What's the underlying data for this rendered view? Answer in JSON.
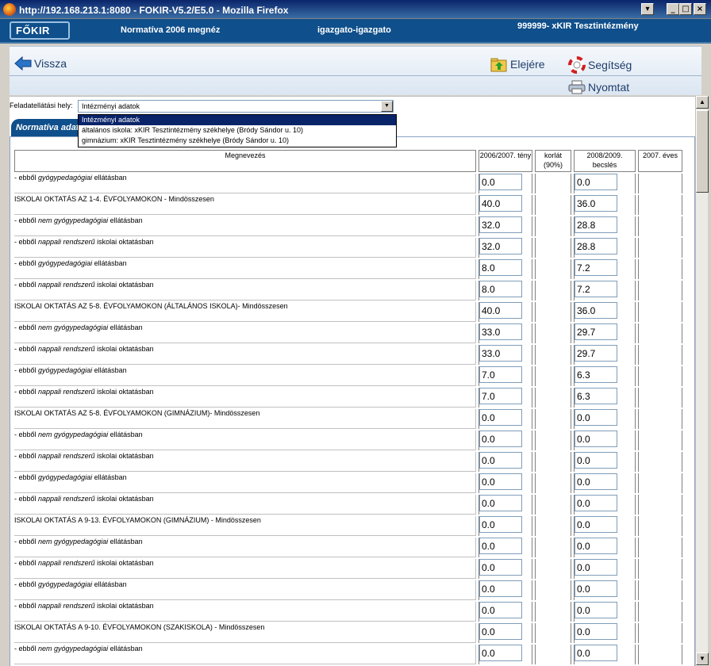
{
  "window": {
    "title": "http://192.168.213.1:8080 - FOKIR-V5.2/E5.0 - Mozilla Firefox",
    "controls": [
      "▾",
      "_",
      "□",
      "×"
    ]
  },
  "header": {
    "logo": "FŐKIR",
    "module": "Normatíva 2006 megnéz",
    "user": "igazgato-igazgato",
    "institution": "999999- xKIR Tesztintézmény"
  },
  "toolbar": {
    "back": "Vissza",
    "top": "Elejére",
    "help": "Segítség",
    "print": "Nyomtat"
  },
  "form": {
    "feladat_label": "Feladatellátási hely:",
    "selected": "Intézményi adatok",
    "options": [
      "Intézményi adatok",
      "általános iskola: xKIR Tesztintézmény székhelye (Bródy Sándor u. 10)",
      "gimnázium: xKIR Tesztintézmény székhelye (Bródy Sándor u. 10)"
    ],
    "tab": "Normatíva adat"
  },
  "table": {
    "headers": [
      "Megnevezés",
      "2006/2007. tény",
      "korlát (90%)",
      "2008/2009. becslés",
      "2007. éves"
    ],
    "rows": [
      {
        "pre": "- ebből ",
        "em": "gyógypedagógiai",
        "post": " ellátásban",
        "v1": "0.0",
        "v2": "0.0"
      },
      {
        "pre": "ISKOLAI OKTATÁS AZ 1-4. ÉVFOLYAMOKON - Mindösszesen",
        "em": "",
        "post": "",
        "v1": "40.0",
        "v2": "36.0"
      },
      {
        "pre": " - ebből ",
        "em": "nem gyógypedagógiai",
        "post": " ellátásban",
        "v1": "32.0",
        "v2": "28.8"
      },
      {
        "pre": "  - ebből ",
        "em": "nappali rendszerű",
        "post": " iskolai oktatásban",
        "v1": "32.0",
        "v2": "28.8"
      },
      {
        "pre": " - ebből ",
        "em": "gyógypedagógiai",
        "post": " ellátásban",
        "v1": "8.0",
        "v2": "7.2"
      },
      {
        "pre": "  - ebből ",
        "em": "nappali rendszerű",
        "post": " iskolai oktatásban",
        "v1": "8.0",
        "v2": "7.2"
      },
      {
        "pre": "ISKOLAI OKTATÁS AZ 5-8. ÉVFOLYAMOKON (ÁLTALÁNOS ISKOLA)- Mindösszesen",
        "em": "",
        "post": "",
        "v1": "40.0",
        "v2": "36.0"
      },
      {
        "pre": " - ebből ",
        "em": "nem gyógypedagógiai",
        "post": " ellátásban",
        "v1": "33.0",
        "v2": "29.7"
      },
      {
        "pre": "  - ebből ",
        "em": "nappali rendszerű",
        "post": " iskolai oktatásban",
        "v1": "33.0",
        "v2": "29.7"
      },
      {
        "pre": " - ebből ",
        "em": "gyógypedagógiai",
        "post": " ellátásban",
        "v1": "7.0",
        "v2": "6.3"
      },
      {
        "pre": "  - ebből ",
        "em": "nappali rendszerű",
        "post": " iskolai oktatásban",
        "v1": "7.0",
        "v2": "6.3"
      },
      {
        "pre": "ISKOLAI OKTATÁS AZ 5-8. ÉVFOLYAMOKON (GIMNÁZIUM)- Mindösszesen",
        "em": "",
        "post": "",
        "v1": "0.0",
        "v2": "0.0"
      },
      {
        "pre": " - ebből ",
        "em": "nem gyógypedagógiai",
        "post": " ellátásban",
        "v1": "0.0",
        "v2": "0.0"
      },
      {
        "pre": "  - ebből ",
        "em": "nappali rendszerű",
        "post": " iskolai oktatásban",
        "v1": "0.0",
        "v2": "0.0"
      },
      {
        "pre": " - ebből ",
        "em": "gyógypedagógiai",
        "post": " ellátásban",
        "v1": "0.0",
        "v2": "0.0"
      },
      {
        "pre": "  - ebből ",
        "em": "nappali rendszerű",
        "post": " iskolai oktatásban",
        "v1": "0.0",
        "v2": "0.0"
      },
      {
        "pre": "ISKOLAI OKTATÁS A 9-13. ÉVFOLYAMOKON (GIMNÁZIUM) - Mindösszesen",
        "em": "",
        "post": "",
        "v1": "0.0",
        "v2": "0.0"
      },
      {
        "pre": " - ebből ",
        "em": "nem gyógypedagógiai",
        "post": " ellátásban",
        "v1": "0.0",
        "v2": "0.0"
      },
      {
        "pre": "  - ebből ",
        "em": "nappali rendszerű",
        "post": " iskolai oktatásban",
        "v1": "0.0",
        "v2": "0.0"
      },
      {
        "pre": " - ebből ",
        "em": "gyógypedagógiai",
        "post": " ellátásban",
        "v1": "0.0",
        "v2": "0.0"
      },
      {
        "pre": "  - ebből ",
        "em": "nappali rendszerű",
        "post": " iskolai oktatásban",
        "v1": "0.0",
        "v2": "0.0"
      },
      {
        "pre": "ISKOLAI OKTATÁS A 9-10. ÉVFOLYAMOKON (SZAKISKOLA) - Mindösszesen",
        "em": "",
        "post": "",
        "v1": "0.0",
        "v2": "0.0"
      },
      {
        "pre": " - ebből ",
        "em": "nem gyógypedagógiai",
        "post": " ellátásban",
        "v1": "0.0",
        "v2": "0.0"
      }
    ]
  }
}
